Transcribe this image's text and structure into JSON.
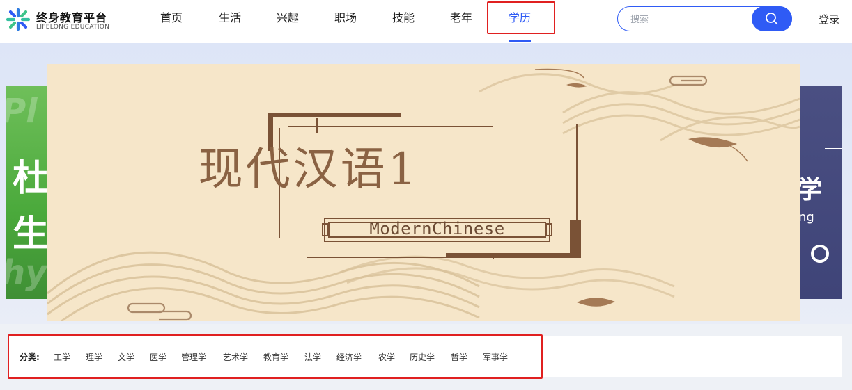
{
  "brand": {
    "name": "终身教育平台",
    "subtitle": "LIFELONG EDUCATION",
    "logo_icon": "burst-logo-icon",
    "accent_color": "#2f5bf5"
  },
  "nav": {
    "items": [
      {
        "label": "首页",
        "active": false
      },
      {
        "label": "生活",
        "active": false
      },
      {
        "label": "兴趣",
        "active": false
      },
      {
        "label": "职场",
        "active": false
      },
      {
        "label": "技能",
        "active": false
      },
      {
        "label": "老年",
        "active": false
      },
      {
        "label": "学历",
        "active": true
      }
    ]
  },
  "search": {
    "placeholder": "搜索",
    "value": "",
    "icon": "search-icon"
  },
  "login_label": "登录",
  "banner": {
    "title": "现代汉语1",
    "subtitle": "ModernChinese",
    "background_color": "#f6e6c9",
    "left_side_text": [
      "杜",
      "生"
    ],
    "right_side_text": "学",
    "right_side_english": "ng"
  },
  "categories": {
    "label": "分类:",
    "items": [
      "工学",
      "理学",
      "文学",
      "医学",
      "管理学",
      "艺术学",
      "教育学",
      "法学",
      "经济学",
      "农学",
      "历史学",
      "哲学",
      "军事学"
    ]
  },
  "highlight_color": "#e02020"
}
